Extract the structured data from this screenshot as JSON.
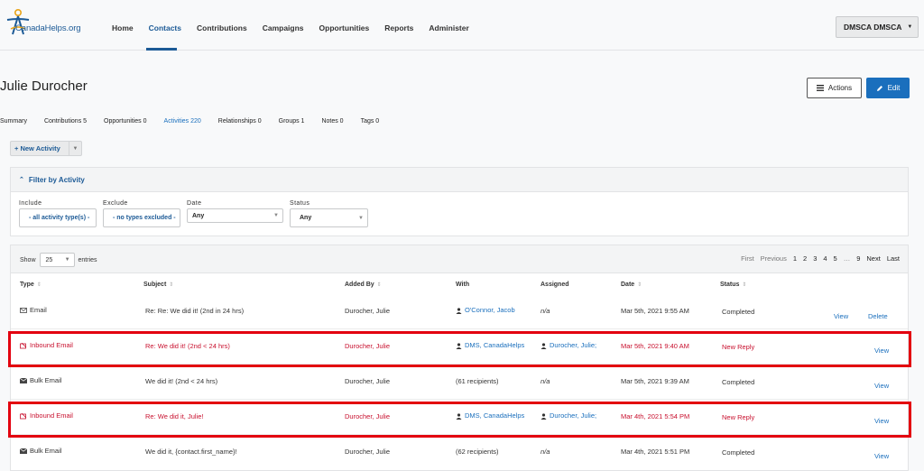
{
  "brand": {
    "logo_text": "CanadaHelps.org"
  },
  "nav": [
    "Home",
    "Contacts",
    "Contributions",
    "Campaigns",
    "Opportunities",
    "Reports",
    "Administer"
  ],
  "user_menu": "DMSCA DMSCA",
  "page_title": "Julie Durocher",
  "buttons": {
    "actions": "Actions",
    "edit": "Edit"
  },
  "tabs": [
    "Summary",
    "Contributions 5",
    "Opportunities 0",
    "Activities 220",
    "Relationships 0",
    "Groups 1",
    "Notes 0",
    "Tags 0"
  ],
  "new_activity": "+ New Activity",
  "filter": {
    "title": "Filter by Activity",
    "include_label": "Include",
    "include_value": "- all activity type(s) -",
    "exclude_label": "Exclude",
    "exclude_value": "- no types excluded -",
    "date_label": "Date",
    "date_value": "Any",
    "status_label": "Status",
    "status_value": "Any"
  },
  "table": {
    "show_label": "Show",
    "entries_value": "25",
    "entries_label": "entries",
    "pager": [
      "First",
      "Previous",
      "1",
      "2",
      "3",
      "4",
      "5",
      "…",
      "9",
      "Next",
      "Last"
    ],
    "headers": [
      "Type",
      "Subject",
      "Added By",
      "With",
      "Assigned",
      "Date",
      "Status"
    ],
    "rows": [
      {
        "type": "Email",
        "subject": "Re: Re: We did it! (2nd in 24 hrs)",
        "added_by": "Durocher, Julie",
        "with": "O'Connor, Jacob",
        "assigned": "n/a",
        "date": "Mar 5th, 2021 9:55 AM",
        "status": "Completed",
        "view": "View",
        "delete": "Delete"
      },
      {
        "type": "Inbound Email",
        "subject": "Re: We did it! (2nd < 24 hrs)",
        "added_by": "Durocher, Julie",
        "with": "DMS, CanadaHelps",
        "assigned": "Durocher, Julie;",
        "date": "Mar 5th, 2021 9:40 AM",
        "status": "New Reply",
        "view": "View"
      },
      {
        "type": "Bulk Email",
        "subject": "We did it! (2nd < 24 hrs)",
        "added_by": "Durocher, Julie",
        "with": "(61 recipients)",
        "assigned": "n/a",
        "date": "Mar 5th, 2021 9:39 AM",
        "status": "Completed",
        "view": "View"
      },
      {
        "type": "Inbound Email",
        "subject": "Re: We did it, Julie!",
        "added_by": "Durocher, Julie",
        "with": "DMS, CanadaHelps",
        "assigned": "Durocher, Julie;",
        "date": "Mar 4th, 2021 5:54 PM",
        "status": "New Reply",
        "view": "View"
      },
      {
        "type": "Bulk Email",
        "subject": "We did it, {contact.first_name}!",
        "added_by": "Durocher, Julie",
        "with": "(62 recipients)",
        "assigned": "n/a",
        "date": "Mar 4th, 2021 5:51 PM",
        "status": "Completed",
        "view": "View"
      }
    ]
  },
  "colors": {
    "accent": "#1a6fbd",
    "highlight": "#e3000f",
    "reply": "#c8102e"
  }
}
